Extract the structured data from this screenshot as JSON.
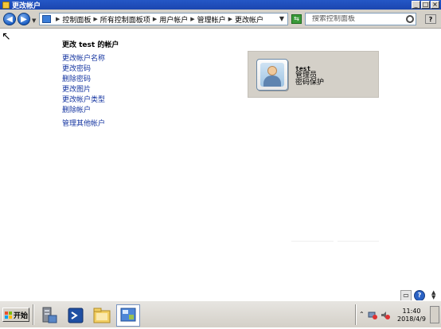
{
  "window": {
    "title": "更改帐户"
  },
  "addressbar": {
    "breadcrumbs": [
      "控制面板",
      "所有控制面板项",
      "用户帐户",
      "管理帐户",
      "更改帐户"
    ],
    "search_placeholder": "搜索控制面板"
  },
  "main": {
    "page_title": "更改 test 的帐户",
    "links": [
      "更改帐户名称",
      "更改密码",
      "删除密码",
      "更改图片",
      "更改帐户类型",
      "删除帐户"
    ],
    "other_link": "管理其他帐户"
  },
  "account": {
    "name": "test",
    "type": "管理员",
    "status": "密码保护"
  },
  "taskbar": {
    "start_label": "开始",
    "time": "11:40",
    "date": "2018/4/9"
  },
  "colors": {
    "titlebar": "#2457c6",
    "link": "#1434a0",
    "card_bg": "#d4d0c8"
  },
  "icons": [
    "back-arrow-icon",
    "forward-arrow-icon",
    "control-panel-icon",
    "refresh-icon",
    "search-icon",
    "help-icon",
    "user-avatar-icon",
    "printer-icon",
    "server-manager-icon",
    "powershell-icon",
    "explorer-folder-icon",
    "control-panel-taskbar-icon",
    "windows-flag-icon"
  ]
}
